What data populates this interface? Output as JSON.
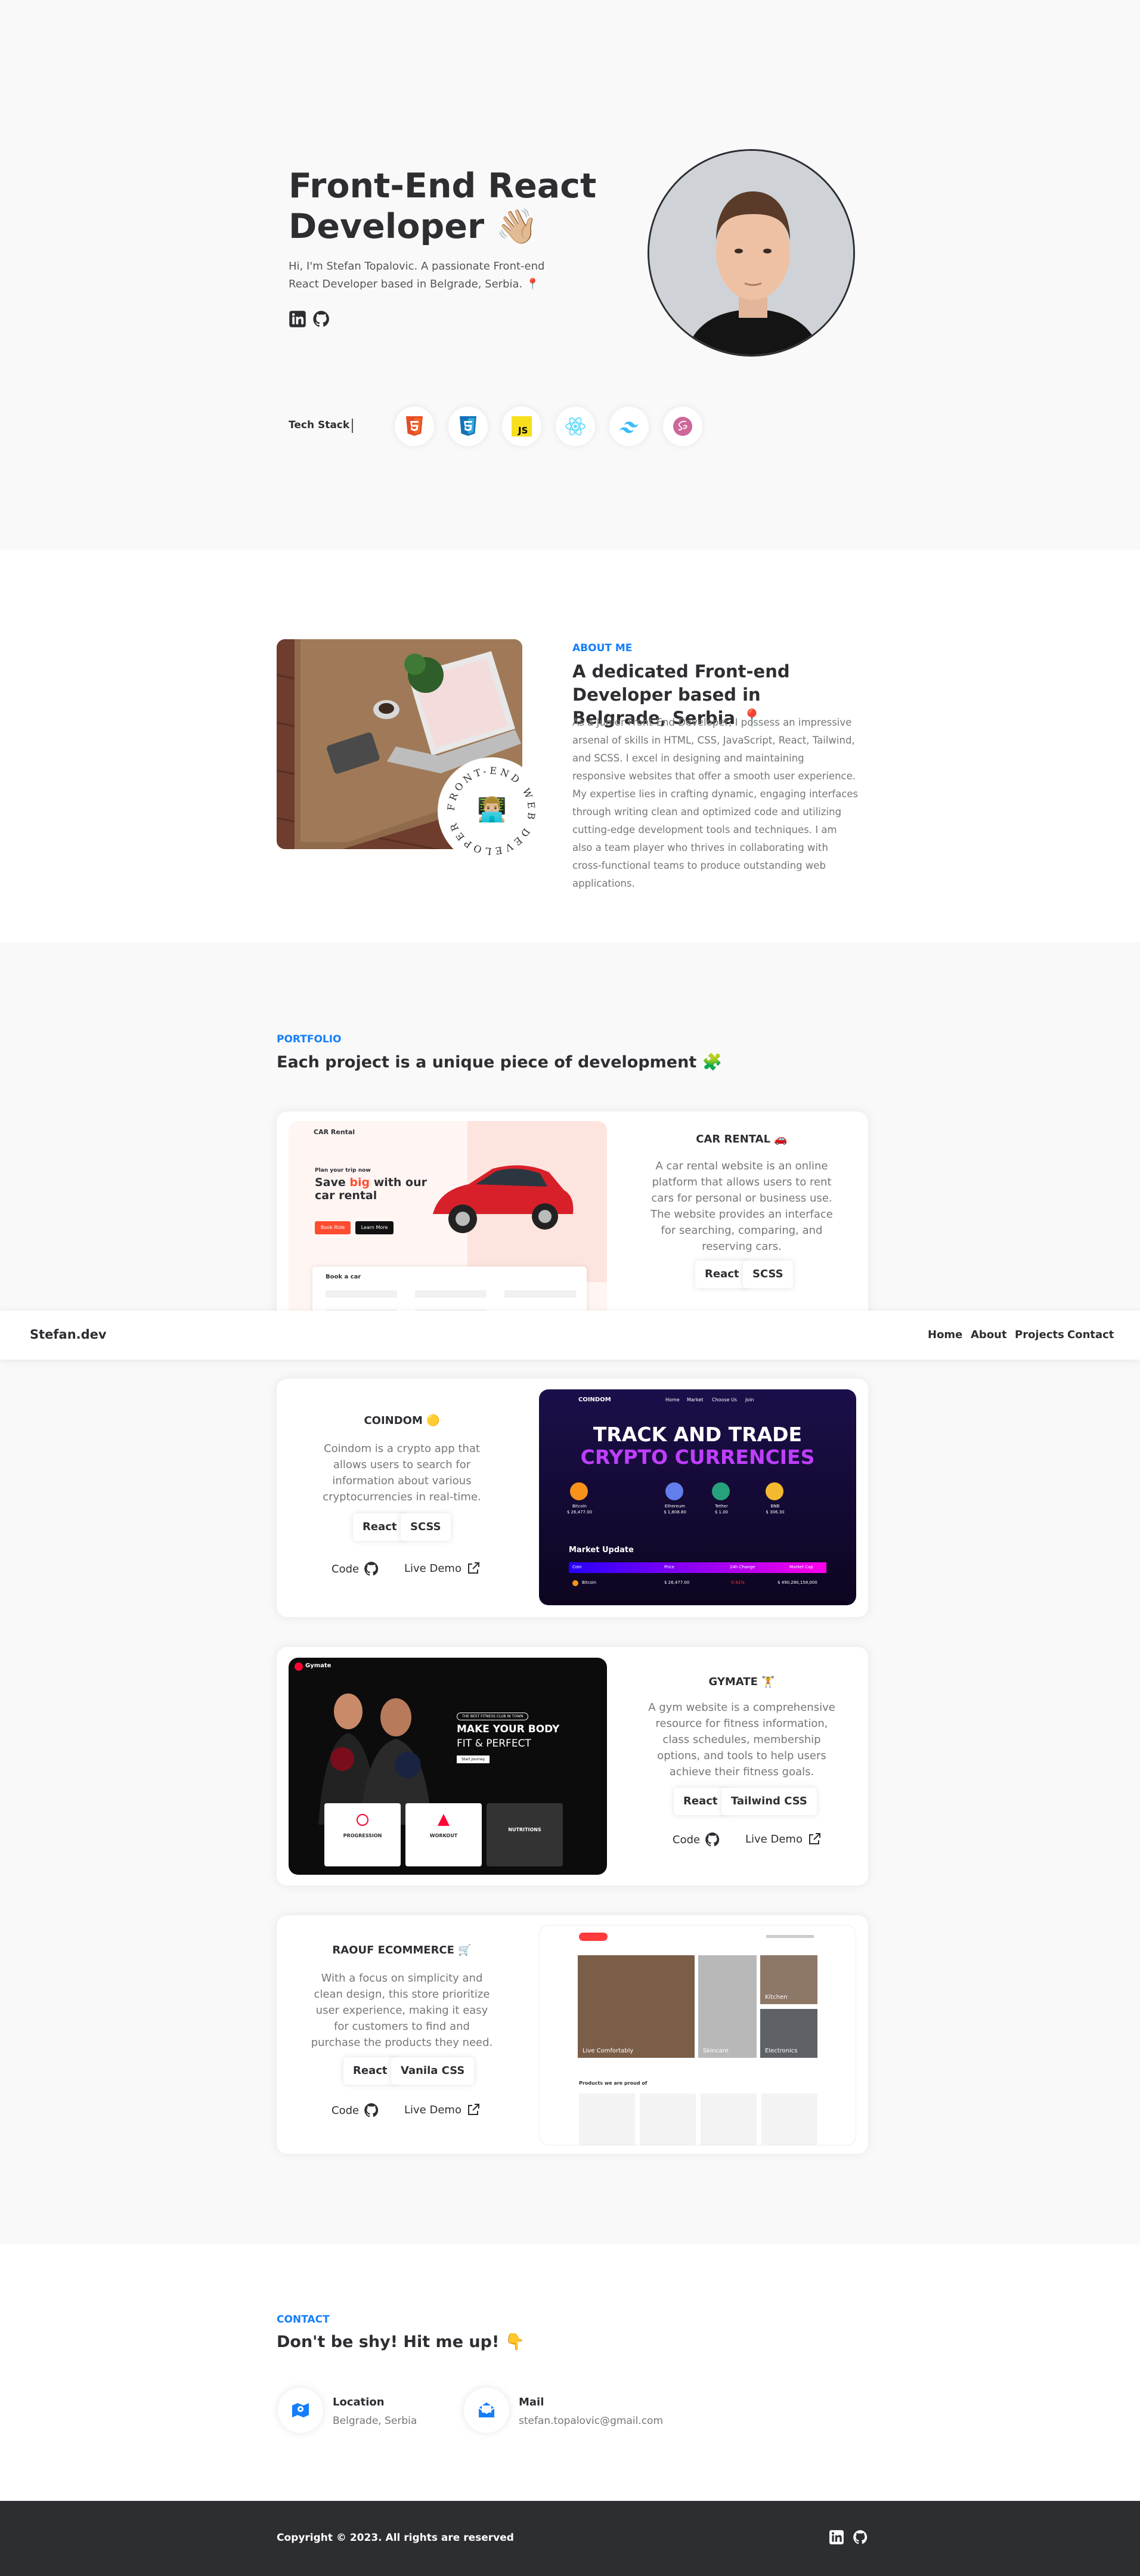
{
  "hero": {
    "title": "Front-End React Developer 👋🏼",
    "intro": "Hi, I'm Stefan Topalovic. A passionate Front-end React Developer based in Belgrade, Serbia. 📍",
    "tech_stack_label": "Tech Stack",
    "tech_icons": [
      "html5-icon",
      "css3-icon",
      "javascript-icon",
      "react-icon",
      "tailwind-icon",
      "sass-icon"
    ],
    "social_icons": [
      "linkedin-icon",
      "github-icon"
    ]
  },
  "about": {
    "eyebrow": "ABOUT ME",
    "heading": "A dedicated Front-end Developer based in Belgrade, Serbia 📍",
    "body": "As a Junior Front-End Developer, I possess an impressive arsenal of skills in HTML, CSS, JavaScript, React, Tailwind, and SCSS. I excel in designing and maintaining responsive websites that offer a smooth user experience. My expertise lies in crafting dynamic, engaging interfaces through writing clean and optimized code and utilizing cutting-edge development tools and techniques. I am also a team player who thrives in collaborating with cross-functional teams to produce outstanding web applications.",
    "badge_text": "FRONT-END WEB DEVELOPER",
    "badge_emoji": "👨🏼‍💻"
  },
  "portfolio": {
    "eyebrow": "PORTFOLIO",
    "heading": "Each project is a unique piece of development 🧩",
    "projects": [
      {
        "name": "CAR RENTAL 🚗",
        "description": "A car rental website is an online platform that allows users to rent cars for personal or business use. The website provides an interface for searching, comparing, and reserving cars.",
        "tags": [
          "React",
          "SCSS"
        ],
        "shot": {
          "brand": "CAR Rental",
          "line1": "Plan your trip now",
          "headline_a": "Save ",
          "headline_b": "big",
          "headline_c": " with our",
          "headline_d": "car rental",
          "btn1": "Book Ride",
          "btn2": "Learn More",
          "form": "Book a car"
        }
      },
      {
        "name": "COINDOM 🟡",
        "description": "Coindom is a crypto app that allows users to search for information about various cryptocurrencies in real-time.",
        "tags": [
          "React",
          "SCSS"
        ],
        "code_label": "Code",
        "demo_label": "Live Demo",
        "shot": {
          "brand": "COINDOM",
          "nav": [
            "Home",
            "Market",
            "Choose Us",
            "Join"
          ],
          "line1": "TRACK AND TRADE",
          "line2": "CRYPTO CURRENCIES",
          "coins": [
            "Bitcoin",
            "Ethereum",
            "Tether",
            "BNB"
          ],
          "prices": [
            "$ 26,477.00",
            "$ 1,808.80",
            "$ 1.00",
            "$ 306.30"
          ],
          "changes": [
            "-0.91%",
            "-0.43%",
            "+0.00%",
            "-0.17%"
          ],
          "market": "Market Update",
          "cols": [
            "Coin",
            "Price",
            "24h Change",
            "Market Cap"
          ],
          "row": [
            "Bitcoin",
            "$ 26,477.00",
            "-0.91%",
            "$ 490,280,158,000"
          ]
        }
      },
      {
        "name": "GYMATE 🏋️",
        "description": "A gym website is a comprehensive resource for fitness information, class schedules, membership options, and tools to help users achieve their fitness goals.",
        "tags": [
          "React",
          "Tailwind CSS"
        ],
        "code_label": "Code",
        "demo_label": "Live Demo",
        "shot": {
          "brand": "Gymate",
          "pill": "THE BEST FITNESS CLUB IN TOWN",
          "line1": "MAKE YOUR BODY",
          "line2": "FIT & PERFECT",
          "cta": "Start Journey",
          "cards": [
            "PROGRESSION",
            "WORKOUT",
            "NUTRITIONS"
          ]
        }
      },
      {
        "name": "RAOUF ECOMMERCE 🛒",
        "description": "With a focus on simplicity and clean design, this store prioritize user experience, making it easy for customers to find and purchase the products they need.",
        "tags": [
          "React",
          "Vanila CSS"
        ],
        "code_label": "Code",
        "demo_label": "Live Demo",
        "shot": {
          "tiles": [
            "Live Comfortably",
            "Skincare",
            "Kitchen",
            "Electronics"
          ],
          "products_label": "Products we are proud of"
        }
      }
    ]
  },
  "nav": {
    "logo": "Stefan.dev",
    "items": [
      "Home",
      "About",
      "Projects",
      "Contact"
    ]
  },
  "contact": {
    "eyebrow": "CONTACT",
    "heading": "Don't be shy! Hit me up! 👇",
    "location_label": "Location",
    "location_value": "Belgrade, Serbia",
    "mail_label": "Mail",
    "mail_value": "stefan.topalovic@gmail.com"
  },
  "footer": {
    "copyright": "Copyright © 2023. All rights are reserved"
  },
  "colors": {
    "accent": "#147efb",
    "dark": "#2d2e32",
    "bg": "#f9f9f9",
    "muted": "#767676"
  }
}
